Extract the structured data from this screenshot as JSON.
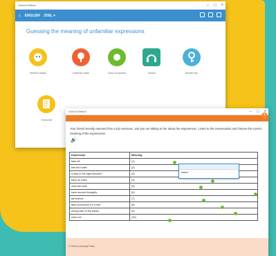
{
  "back_window": {
    "app_title": "Oxford Reflect",
    "nav": {
      "back_chevron": "‹",
      "course": "ENGLISH",
      "level": "JOEL ▾"
    },
    "page_title": "Guessing the meaning of unfamiliar expressions",
    "tiles": [
      {
        "label": "Student visuals",
        "icon": "face-icon",
        "color": "#f5c21b"
      },
      {
        "label": "Grammar notes",
        "icon": "pin-icon",
        "color": "#ef6133"
      },
      {
        "label": "Class companion",
        "icon": "donut-icon",
        "color": "#6dbb2e"
      },
      {
        "label": "Tutorial",
        "icon": "headphones-icon",
        "color": "#2fa88e"
      },
      {
        "label": "Answer key",
        "icon": "key-icon",
        "color": "#4cb1d8"
      },
      {
        "label": "Transcript",
        "icon": "document-icon",
        "color": "#f5c21b"
      }
    ]
  },
  "front_window": {
    "app_title": "Oxford Reflect",
    "instructions": "Your friend recently returned from a trip overseas, and you are talking to her about her experiences. Listen to the conversation and choose the correct meaning of the expressions.",
    "table": {
      "headers": [
        "Expression",
        "Meaning"
      ],
      "rows": [
        [
          "take off",
          "(1)"
        ],
        [
          "bite the bullet",
          "(2)"
        ],
        [
          "a step in the right direction",
          "(3)"
        ],
        [
          "back on track",
          "(4)"
        ],
        [
          "miss the boat",
          "(5)"
        ],
        [
          "have second thoughts",
          "(6)"
        ],
        [
          "fall behind",
          "(7)"
        ],
        [
          "take (someone) for a ride",
          "(8)"
        ],
        [
          "wrong side of the tracks",
          "(9)"
        ],
        [
          "worn out",
          "(10)"
        ]
      ]
    },
    "dropdown_option": "Select",
    "footer_copyright": "© Oxford University Press"
  },
  "colors": {
    "accent_blue": "#3b8fce",
    "orange": "#ef7b24",
    "green_dot": "#6dbb2e",
    "teal_bg": "#3fbcb2",
    "yellow_bg": "#f6c31b"
  }
}
